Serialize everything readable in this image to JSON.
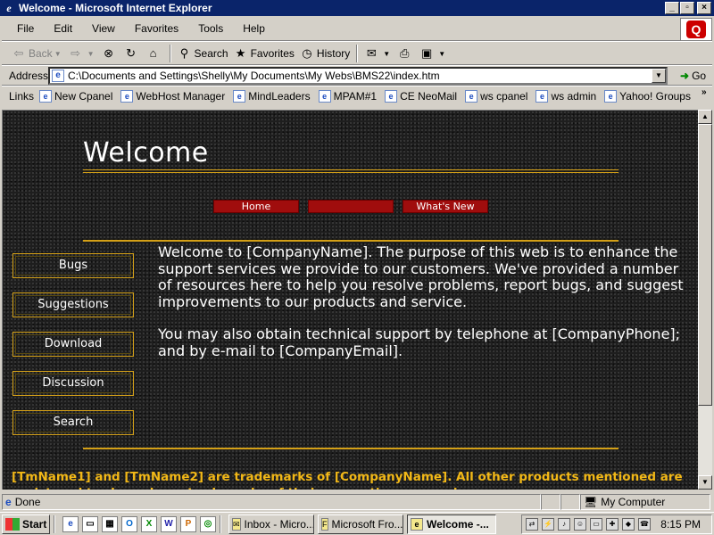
{
  "window": {
    "title": "Welcome - Microsoft Internet Explorer",
    "min": "_",
    "max": "▫",
    "close": "×"
  },
  "menu": [
    "File",
    "Edit",
    "View",
    "Favorites",
    "Tools",
    "Help"
  ],
  "toolbar": {
    "back": "Back",
    "search": "Search",
    "favorites": "Favorites",
    "history": "History"
  },
  "address": {
    "label": "Address",
    "url": "C:\\Documents and Settings\\Shelly\\My Documents\\My Webs\\BMS22\\index.htm",
    "go": "Go"
  },
  "links": {
    "label": "Links",
    "items": [
      "New Cpanel",
      "WebHost Manager",
      "MindLeaders",
      "MPAM#1",
      "CE NeoMail",
      "ws cpanel",
      "ws admin",
      "Yahoo! Groups"
    ]
  },
  "page": {
    "title": "Welcome",
    "nav": [
      "Home",
      "",
      "What's New"
    ],
    "side": [
      "Bugs",
      "Suggestions",
      "Download",
      "Discussion",
      "Search"
    ],
    "intro": [
      "Welcome to [CompanyName]. The purpose of this web is to enhance the support services we provide to our customers. We've provided a number of resources here to help you resolve problems, report bugs, and suggest improvements to our products and service.",
      "You may also obtain technical support by telephone at [CompanyPhone]; and by e-mail to [CompanyEmail]."
    ],
    "footer": "[TmName1] and [TmName2] are trademarks of [CompanyName]. All other products mentioned are registered trademarks or trademarks of their respective companies."
  },
  "status": {
    "text": "Done",
    "zone": "My Computer"
  },
  "taskbar": {
    "start": "Start",
    "tasks": [
      "Inbox - Micro...",
      "Microsoft Fro...",
      "Welcome -..."
    ],
    "clock": "8:15 PM"
  },
  "colors": {
    "titlebar": "#0a246a",
    "gold": "#d4a017",
    "navred": "#a00d0d",
    "footer": "#f2b817"
  }
}
